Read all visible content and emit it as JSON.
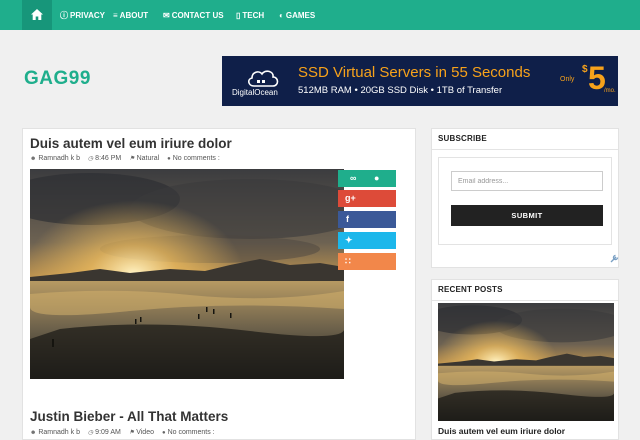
{
  "nav": {
    "home_icon": "home-icon",
    "items": [
      {
        "label": "PRIVACY",
        "icon": "info-icon",
        "glyph": "ⓘ"
      },
      {
        "label": "ABOUT",
        "icon": "menu-icon",
        "glyph": "≡"
      },
      {
        "label": "CONTACT US",
        "icon": "mail-icon",
        "glyph": "✉"
      },
      {
        "label": "TECH",
        "icon": "mobile-icon",
        "glyph": "▯"
      },
      {
        "label": "GAMES",
        "icon": "gamepad-icon",
        "glyph": "◐"
      }
    ]
  },
  "header": {
    "logo": "GAG99"
  },
  "ad": {
    "brand": "DigitalOcean",
    "headline": "SSD Virtual Servers in 55 Seconds",
    "specs": "512MB RAM  •  20GB SSD Disk  •  1TB of Transfer",
    "only": "Only",
    "dollar": "$",
    "price": "5",
    "per": "/mo."
  },
  "posts": [
    {
      "title": "Duis autem vel eum iriure dolor",
      "author": "Ramnadh k b",
      "time": "8:46 PM",
      "label": "Natural",
      "comments": "No comments :"
    },
    {
      "title": "Justin Bieber - All That Matters",
      "author": "Ramnadh k b",
      "time": "9:09 AM",
      "label": "Video",
      "comments": "No comments :"
    }
  ],
  "share": [
    {
      "name": "link-chat",
      "color": "#1fae8c",
      "glyphs": [
        "⚙",
        "●"
      ]
    },
    {
      "name": "google-plus",
      "color": "#dd4b39",
      "glyphs": [
        "g+"
      ]
    },
    {
      "name": "facebook",
      "color": "#3b5998",
      "glyphs": [
        "f"
      ]
    },
    {
      "name": "twitter",
      "color": "#1cb7eb",
      "glyphs": [
        "✦"
      ]
    },
    {
      "name": "rss",
      "color": "#f2874a",
      "glyphs": [
        "∷"
      ]
    }
  ],
  "sidebar": {
    "subscribe": {
      "title": "SUBSCRIBE",
      "placeholder": "Email address...",
      "button": "SUBMIT"
    },
    "recent": {
      "title": "RECENT POSTS",
      "items": [
        "Duis autem vel eum iriure dolor"
      ]
    }
  },
  "colors": {
    "accent": "#1fae8c",
    "nav_active": "#17967a",
    "ad_bg": "#0f1f49",
    "ad_orange": "#f7a21b"
  }
}
